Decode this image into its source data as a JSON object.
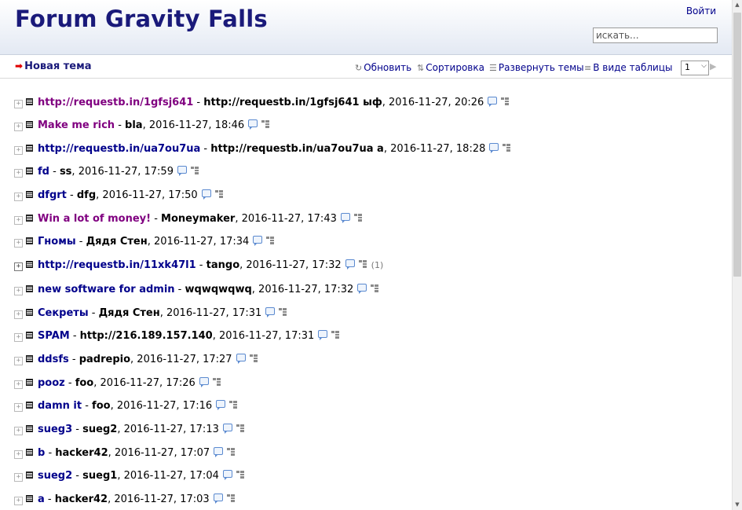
{
  "header": {
    "title": "Forum Gravity Falls",
    "login_label": "Войти",
    "search_placeholder": "искать..."
  },
  "toolbar": {
    "new_topic_label": "Новая тема",
    "refresh_label": "Обновить",
    "sort_label": "Сортировка",
    "expand_label": "Развернуть темы",
    "table_view_label": "В виде таблицы",
    "page_value": "1"
  },
  "topics": [
    {
      "subject": "http://requestb.in/1gfsj641",
      "author": "http://requestb.in/1gfsj641 ыф",
      "date": "2016-11-27, 20:26",
      "visited": true,
      "expand": "+",
      "count": ""
    },
    {
      "subject": "Make me rich",
      "author": "bla",
      "date": "2016-11-27, 18:46",
      "visited": true,
      "expand": "+",
      "count": ""
    },
    {
      "subject": "http://requestb.in/ua7ou7ua",
      "author": "http://requestb.in/ua7ou7ua a",
      "date": "2016-11-27, 18:28",
      "visited": false,
      "expand": "+",
      "count": ""
    },
    {
      "subject": "fd",
      "author": "ss",
      "date": "2016-11-27, 17:59",
      "visited": false,
      "expand": "+",
      "count": ""
    },
    {
      "subject": "dfgrt",
      "author": "dfg",
      "date": "2016-11-27, 17:50",
      "visited": false,
      "expand": "+",
      "count": ""
    },
    {
      "subject": "Win a lot of money!",
      "author": "Moneymaker",
      "date": "2016-11-27, 17:43",
      "visited": true,
      "expand": "+",
      "count": ""
    },
    {
      "subject": "Гномы",
      "author": "Дядя Стен",
      "date": "2016-11-27, 17:34",
      "visited": false,
      "expand": "+",
      "count": ""
    },
    {
      "subject": "http://requestb.in/11xk47l1",
      "author": "tango",
      "date": "2016-11-27, 17:32",
      "visited": false,
      "expand": "+",
      "count": "(1)"
    },
    {
      "subject": "new software for admin",
      "author": "wqwqwqwq",
      "date": "2016-11-27, 17:32",
      "visited": false,
      "expand": "+",
      "count": ""
    },
    {
      "subject": "Секреты",
      "author": "Дядя Стен",
      "date": "2016-11-27, 17:31",
      "visited": false,
      "expand": "+",
      "count": ""
    },
    {
      "subject": "SPAM",
      "author": "http://216.189.157.140",
      "date": "2016-11-27, 17:31",
      "visited": false,
      "expand": "+",
      "count": ""
    },
    {
      "subject": "ddsfs",
      "author": "padrepio",
      "date": "2016-11-27, 17:27",
      "visited": false,
      "expand": "+",
      "count": ""
    },
    {
      "subject": "pooz",
      "author": "foo",
      "date": "2016-11-27, 17:26",
      "visited": false,
      "expand": "+",
      "count": ""
    },
    {
      "subject": "damn it",
      "author": "foo",
      "date": "2016-11-27, 17:16",
      "visited": false,
      "expand": "+",
      "count": ""
    },
    {
      "subject": "sueg3",
      "author": "sueg2",
      "date": "2016-11-27, 17:13",
      "visited": false,
      "expand": "+",
      "count": ""
    },
    {
      "subject": "b",
      "author": "hacker42",
      "date": "2016-11-27, 17:07",
      "visited": false,
      "expand": "+",
      "count": ""
    },
    {
      "subject": "sueg2",
      "author": "sueg1",
      "date": "2016-11-27, 17:04",
      "visited": false,
      "expand": "+",
      "count": ""
    },
    {
      "subject": "a",
      "author": "hacker42",
      "date": "2016-11-27, 17:03",
      "visited": false,
      "expand": "+",
      "count": ""
    }
  ],
  "colors": {
    "link": "#00008b",
    "visited": "#800080",
    "title": "#1a1a7a",
    "new_topic_arrow": "#e00000"
  },
  "icons": {
    "new_topic": "arrow-right-icon",
    "refresh": "refresh-icon",
    "sort": "sort-icon",
    "expand": "expand-list-icon",
    "table": "table-view-icon",
    "next": "next-page-icon",
    "row_expander": "plus-box-icon",
    "row_doc": "document-icon",
    "row_bubble": "speech-bubble-icon",
    "row_tree": "thread-tree-icon"
  }
}
